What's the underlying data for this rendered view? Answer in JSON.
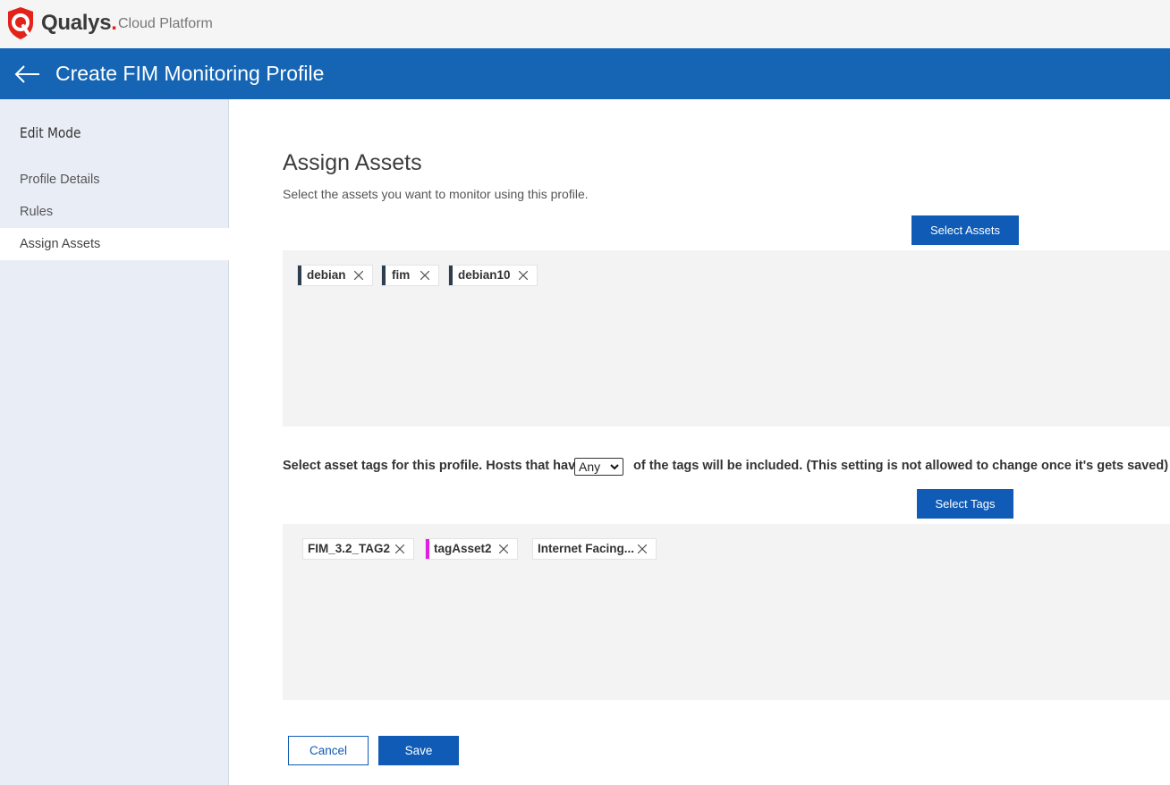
{
  "brand": {
    "name": "Qualys",
    "dot": ".",
    "subtitle": "Cloud Platform",
    "accent_color": "#e2231a"
  },
  "header": {
    "title": "Create FIM Monitoring Profile",
    "back_icon": "arrow-left-icon",
    "color": "#1565b4"
  },
  "sidebar": {
    "heading": "Edit Mode",
    "items": [
      {
        "label": "Profile Details",
        "active": false
      },
      {
        "label": "Rules",
        "active": false
      },
      {
        "label": "Assign Assets",
        "active": true
      }
    ]
  },
  "main": {
    "title": "Assign Assets",
    "description": "Select the assets you want to monitor using this profile.",
    "select_assets_label": "Select Assets",
    "assets": [
      {
        "label": "debian",
        "tag_color": "#2d3e50"
      },
      {
        "label": "fim",
        "tag_color": "#2d3e50"
      },
      {
        "label": "debian10",
        "tag_color": "#2d3e50"
      }
    ],
    "tags_sentence_before": "Select asset tags for this profile. Hosts that have",
    "tags_match_option": "Any",
    "tags_sentence_after": "of the tags will be included. (This setting is not allowed to change once it's gets saved)",
    "select_tags_label": "Select Tags",
    "tags": [
      {
        "label": "FIM_3.2_TAG2",
        "tag_color": ""
      },
      {
        "label": "tagAsset2",
        "tag_color": "#e020e0"
      },
      {
        "label": "Internet Facing...",
        "tag_color": ""
      }
    ]
  },
  "footer": {
    "cancel_label": "Cancel",
    "save_label": "Save"
  }
}
